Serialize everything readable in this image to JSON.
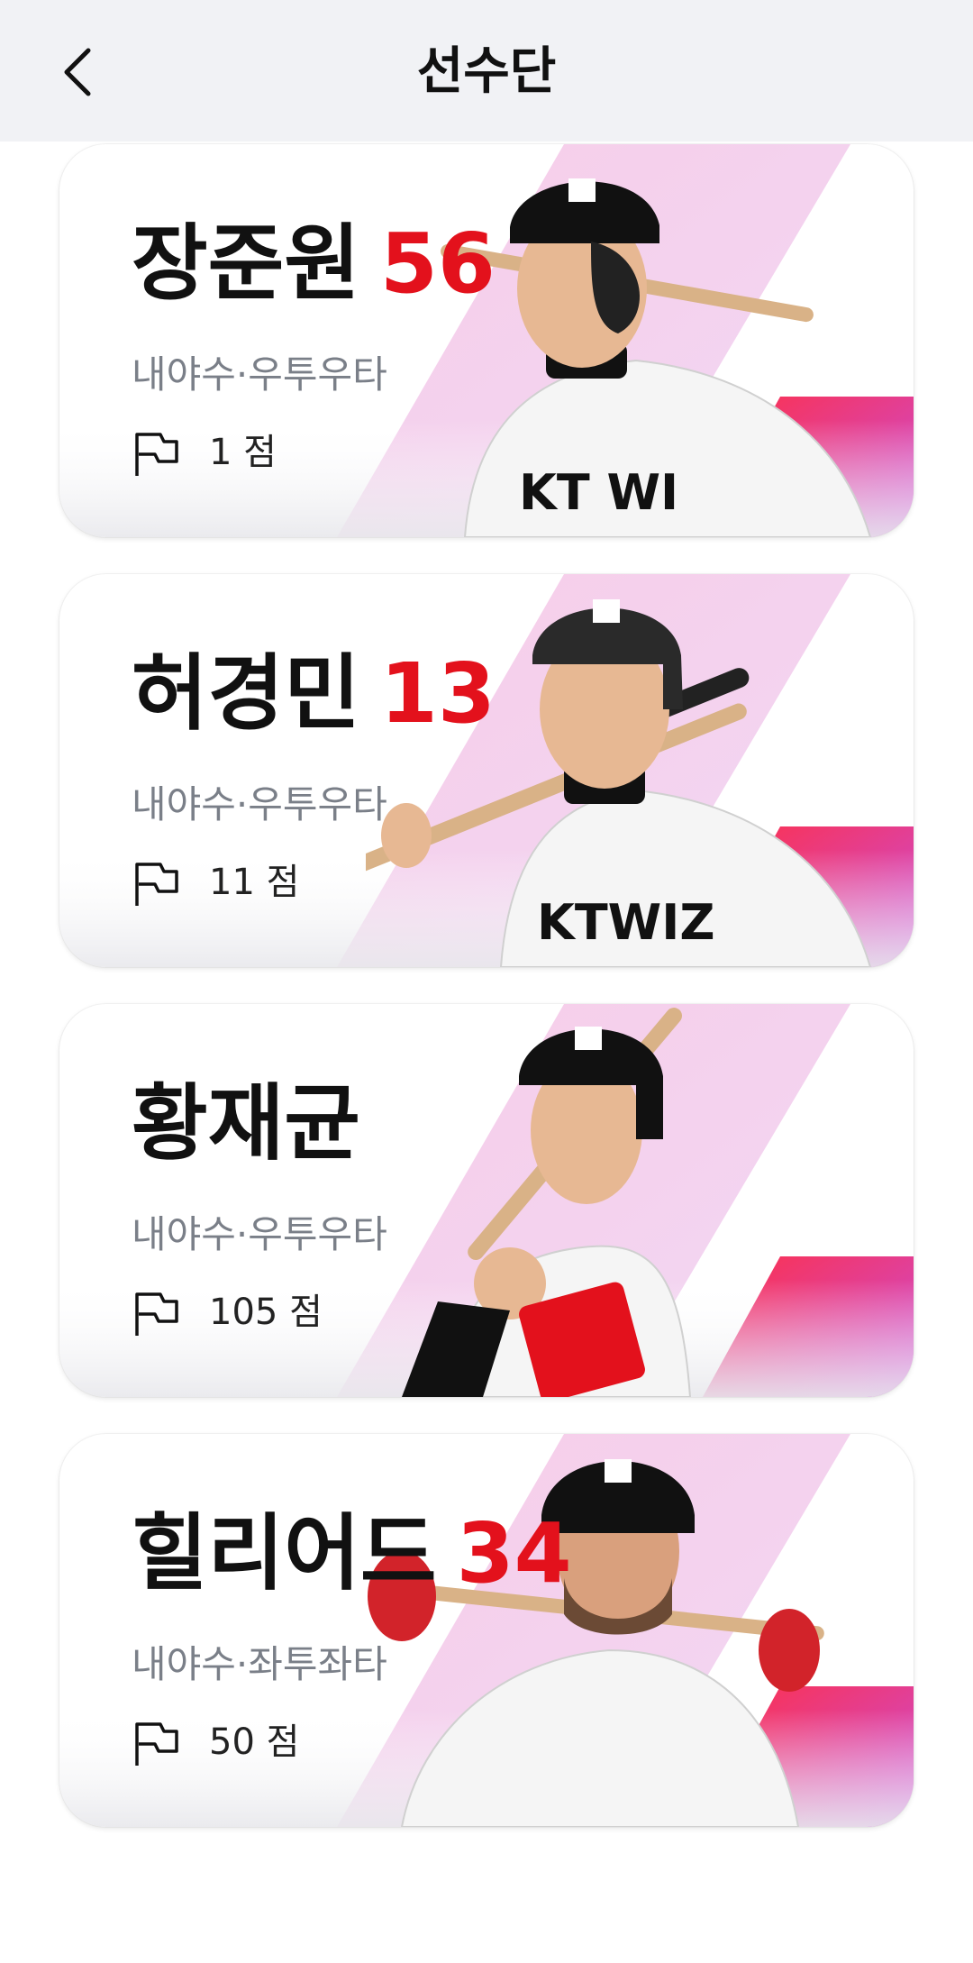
{
  "header": {
    "title": "선수단"
  },
  "players": [
    {
      "name": "장준원",
      "number": "56",
      "position": "내야수·우투우타",
      "score": "1 점",
      "photo": "player-photo-helmet-bat-shoulder"
    },
    {
      "name": "허경민",
      "number": "13",
      "position": "내야수·우투우타",
      "score": "11 점",
      "photo": "player-photo-helmet-bat-shoulder"
    },
    {
      "name": "황재균",
      "number": "",
      "position": "내야수·우투우타",
      "score": "105 점",
      "photo": "player-photo-helmet-batting-stance"
    },
    {
      "name": "힐리어드",
      "number": "34",
      "position": "내야수·좌투좌타",
      "score": "50 점",
      "photo": "player-photo-helmet-bat-shoulder"
    }
  ],
  "colors": {
    "accent": "#e3111c",
    "header_bg": "#f1f2f5",
    "gradient_pink": "#f5c6e6",
    "gradient_red": "#ff2f45",
    "gradient_purple": "#c84ee0"
  },
  "icons": {
    "back": "chevron-left-icon",
    "score": "flag-icon"
  }
}
